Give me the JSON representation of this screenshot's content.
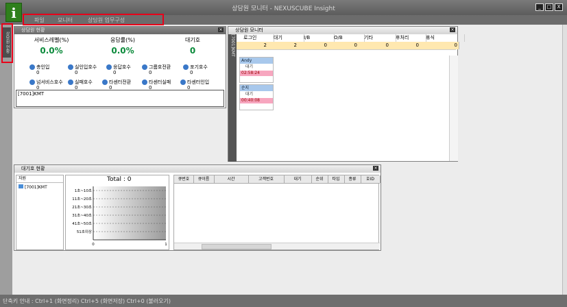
{
  "window": {
    "title": "상담원 모니터 - NEXUSCUBE Insight",
    "logo": "i",
    "buttons": [
      "_",
      "□",
      "X"
    ]
  },
  "menu": [
    "파일",
    "모니터",
    "상담원 업무구성"
  ],
  "left_tab": "상담원 현황",
  "status_bar": "단축키 안내 : Ctrl+1 (화면정리) Ctrl+5 (화면저장) Ctrl+0 (불러오기)",
  "summary_panel": {
    "title": "상담원 현황",
    "stats": [
      {
        "label": "서비스레벨(%)",
        "value": "0.0%"
      },
      {
        "label": "응답률(%)",
        "value": "0.0%"
      },
      {
        "label": "대기호",
        "value": "0"
      }
    ],
    "counters": [
      {
        "label": "총인입",
        "value": "0"
      },
      {
        "label": "실인입호수",
        "value": "0"
      },
      {
        "label": "응답호수",
        "value": "0"
      },
      {
        "label": "그룹호전환",
        "value": "0"
      },
      {
        "label": "포기호수",
        "value": "0"
      },
      {
        "label": "넘서비스호수",
        "value": "0"
      },
      {
        "label": "실패호수",
        "value": "0"
      },
      {
        "label": "타센터전환",
        "value": "0"
      },
      {
        "label": "타센터실패",
        "value": "0"
      },
      {
        "label": "타센터인입",
        "value": "0"
      }
    ],
    "list_item": "[7001]KMT"
  },
  "agent_panel": {
    "title": "상담원 모니터",
    "side_label": "[7001]KMT",
    "columns": [
      {
        "label": "로그인",
        "count": "2"
      },
      {
        "label": "대기",
        "count": "2"
      },
      {
        "label": "I/B",
        "count": "0"
      },
      {
        "label": "O/B",
        "count": "0"
      },
      {
        "label": "기타",
        "count": "0"
      },
      {
        "label": "후처리",
        "count": "0"
      },
      {
        "label": "휴식",
        "count": "0"
      }
    ],
    "agents": [
      {
        "name": "Andy",
        "state": "대기",
        "time": "02:58:24"
      },
      {
        "name": "순지",
        "state": "대기",
        "time": "00:40:08"
      }
    ]
  },
  "queue_panel": {
    "title": "대기호 현황",
    "tree_header": "자원",
    "tree_item": "[7001]KMT",
    "total_label": "Total",
    "total_value": "0",
    "chart_axis_start": "0",
    "chart_axis_end": "1",
    "grid_columns": [
      "큐번호",
      "큐이름",
      "시간",
      "고객번호",
      "대기",
      "순위",
      "타입",
      "종류",
      "호ID"
    ]
  },
  "chart_data": {
    "type": "bar",
    "title": "Total : 0",
    "categories": [
      "1초~10초",
      "11초~20초",
      "21초~30초",
      "31초~40초",
      "41초~50초",
      "51초이상"
    ],
    "values": [
      0,
      0,
      0,
      0,
      0,
      0
    ],
    "xlim": [
      0,
      1
    ],
    "grid": true,
    "orientation": "horizontal"
  }
}
